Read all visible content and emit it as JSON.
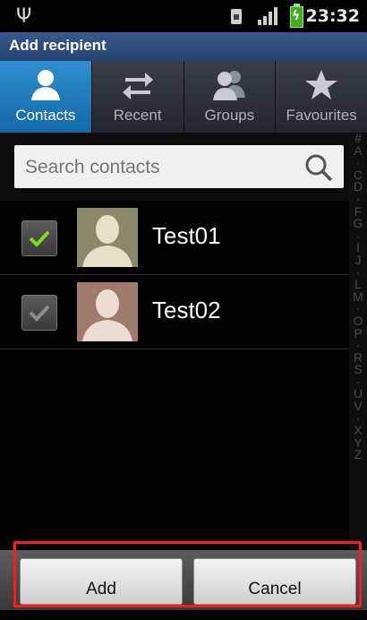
{
  "status_bar": {
    "time": "23:32",
    "icons": [
      "usb-icon",
      "sim-icon",
      "signal-icon",
      "battery-charging-icon"
    ]
  },
  "title_bar": {
    "title": "Add recipient"
  },
  "tabs": [
    {
      "label": "Contacts",
      "icon": "person-icon",
      "active": true
    },
    {
      "label": "Recent",
      "icon": "swap-arrows-icon",
      "active": false
    },
    {
      "label": "Groups",
      "icon": "group-icon",
      "active": false
    },
    {
      "label": "Favourites",
      "icon": "star-icon",
      "active": false
    }
  ],
  "search": {
    "placeholder": "Search contacts",
    "value": ""
  },
  "contacts": [
    {
      "name": "Test01",
      "checked": true,
      "avatar_color": "#8a8a6a"
    },
    {
      "name": "Test02",
      "checked": false,
      "avatar_color": "#a07a6a"
    }
  ],
  "index_letters": [
    "#",
    "A",
    "·",
    "C",
    "D",
    "·",
    "F",
    "G",
    "·",
    "I",
    "J",
    "·",
    "L",
    "M",
    "·",
    "O",
    "P",
    "·",
    "R",
    "S",
    "·",
    "U",
    "V",
    "·",
    "X",
    "Y",
    "Z"
  ],
  "buttons": {
    "add_label": "Add",
    "cancel_label": "Cancel"
  },
  "colors": {
    "accent": "#1e7cc0",
    "highlight": "#ff1a1a",
    "check_green": "#7fd81e"
  }
}
